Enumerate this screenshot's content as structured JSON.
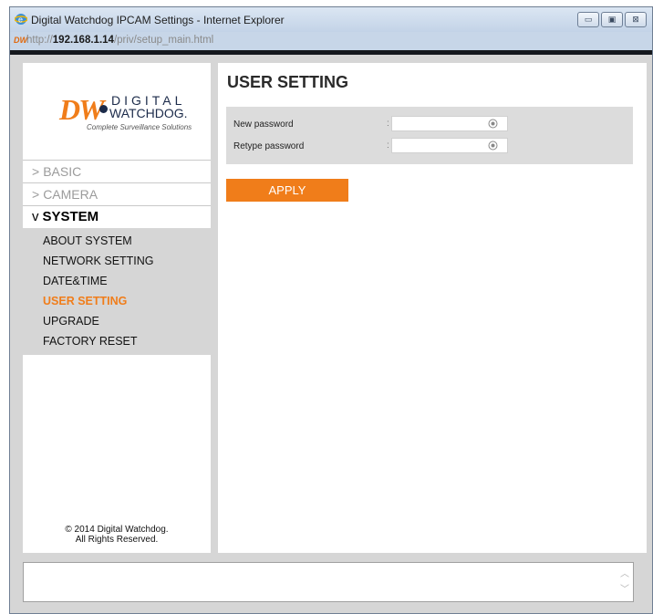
{
  "window": {
    "title": "Digital Watchdog IPCAM Settings - Internet Explorer",
    "url_scheme": "http://",
    "url_host": "192.168.1.14",
    "url_path": "/priv/setup_main.html",
    "favicon_text": "DW"
  },
  "logo": {
    "mark": "DW",
    "line1": "DIGITAL",
    "line2": "WATCHDOG.",
    "tagline": "Complete Surveillance Solutions"
  },
  "nav": {
    "basic": {
      "caret": ">",
      "label": "BASIC"
    },
    "camera": {
      "caret": ">",
      "label": "CAMERA"
    },
    "system": {
      "caret": "v",
      "label": "SYSTEM"
    },
    "system_items": [
      {
        "label": "ABOUT SYSTEM",
        "active": false
      },
      {
        "label": "NETWORK SETTING",
        "active": false
      },
      {
        "label": "DATE&TIME",
        "active": false
      },
      {
        "label": "USER SETTING",
        "active": true
      },
      {
        "label": "UPGRADE",
        "active": false
      },
      {
        "label": "FACTORY RESET",
        "active": false
      }
    ]
  },
  "footer": {
    "line1": "© 2014 Digital Watchdog.",
    "line2": "All Rights Reserved."
  },
  "main": {
    "title": "USER SETTING",
    "fields": [
      {
        "label": "New password",
        "colon": ":",
        "value": ""
      },
      {
        "label": "Retype password",
        "colon": ":",
        "value": ""
      }
    ],
    "apply_label": "APPLY"
  },
  "colors": {
    "accent": "#f07d1a",
    "panel_gray": "#d6d6d6"
  },
  "icons": {
    "browser": "ie-icon",
    "show_password": "eye-icon"
  }
}
